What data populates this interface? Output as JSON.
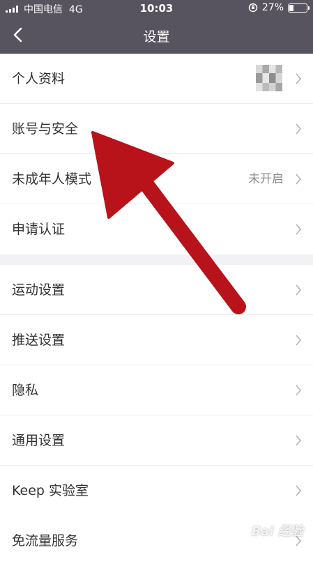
{
  "status_bar": {
    "carrier": "中国电信",
    "network": "4G",
    "time": "10:03",
    "battery": "27%",
    "battery_level": 0.27
  },
  "header": {
    "title": "设置",
    "back_icon": "chevron-left-icon"
  },
  "section1": {
    "items": [
      {
        "label": "个人资料",
        "value": ""
      },
      {
        "label": "账号与安全",
        "value": ""
      },
      {
        "label": "未成年人模式",
        "value": "未开启"
      },
      {
        "label": "申请认证",
        "value": ""
      }
    ]
  },
  "section2": {
    "items": [
      {
        "label": "运动设置",
        "value": ""
      },
      {
        "label": "推送设置",
        "value": ""
      },
      {
        "label": "隐私",
        "value": ""
      },
      {
        "label": "通用设置",
        "value": ""
      },
      {
        "label": "Keep 实验室",
        "value": ""
      }
    ]
  },
  "section3": {
    "items": [
      {
        "label": "免流量服务",
        "value": ""
      }
    ]
  },
  "colors": {
    "header_bg": "#57535f",
    "page_bg": "#f2f2f4",
    "arrow": "#b8121b"
  },
  "watermark": "Bai 经验"
}
